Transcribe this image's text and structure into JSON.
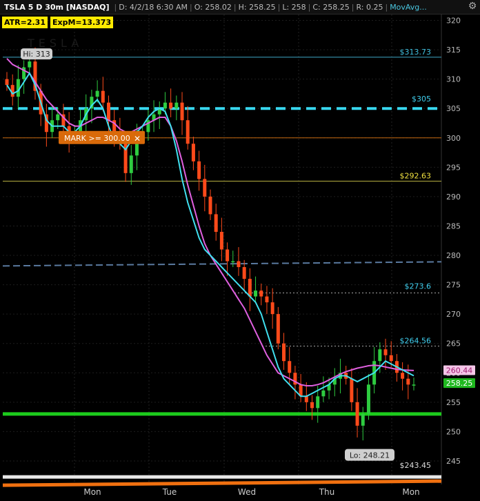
{
  "header": {
    "symbol": "TSLA 5 D 30m [NASDAQ]",
    "date": "D: 4/2/18 6:30 AM",
    "open": "O: 258.02",
    "high": "H: 258.25",
    "low": "L: 258",
    "close": "C: 258.25",
    "range": "R: 0.25",
    "study": "MovAvg..."
  },
  "studies": {
    "atr": "ATR=2.31",
    "expm": "ExpM=13.373"
  },
  "labels": {
    "hi": "Hi: 313",
    "lo": "Lo: 248.21",
    "mark": "MARK >= 300.00",
    "mark_close": "✕",
    "price_313": "$313.73",
    "price_305": "$305",
    "price_292": "$292.63",
    "price_273": "$273.6",
    "price_264": "$264.56",
    "price_243": "$243.45",
    "last_ma": "260.44",
    "last_price": "258.25"
  },
  "colors": {
    "up": "#2ecc40",
    "down": "#ff4a1a",
    "fast_ma": "#40e0f0",
    "slow_ma": "#e060e0",
    "support": "#1ccc1c",
    "resistance": "#38d8f0"
  },
  "chart_data": {
    "type": "line",
    "title": "TSLA 5 D 30m [NASDAQ]",
    "ylim": [
      241,
      321
    ],
    "y_ticks": [
      245,
      250,
      255,
      260,
      265,
      270,
      275,
      280,
      285,
      290,
      295,
      300,
      305,
      310,
      315,
      320
    ],
    "x_categories": [
      "Mon",
      "Tue",
      "Wed",
      "Thu",
      "Mon"
    ],
    "series": [
      {
        "name": "close",
        "values": [
          309,
          307,
          310,
          312,
          313,
          308,
          304,
          301,
          303,
          304,
          302,
          300,
          301,
          303,
          305,
          307,
          308,
          306,
          303,
          301,
          299,
          294,
          297,
          300,
          301,
          303,
          304,
          305,
          306,
          305,
          306,
          303,
          299,
          296,
          293,
          290,
          287,
          284,
          281,
          279,
          279,
          278,
          276,
          273,
          274,
          273,
          272,
          270,
          265,
          262,
          260,
          258,
          256,
          255,
          254,
          256,
          257,
          258,
          259,
          260,
          259,
          255,
          251,
          253,
          258,
          262,
          264,
          263,
          262,
          260,
          259,
          258,
          258
        ]
      },
      {
        "name": "fast moving average",
        "values": [
          309,
          307.5,
          308,
          309.5,
          311,
          309,
          306,
          303,
          302,
          302,
          302,
          301,
          301,
          302,
          304,
          305.5,
          306.5,
          305,
          302,
          299.5,
          299,
          298,
          299.5,
          301,
          302,
          303.5,
          304.5,
          305,
          304.5,
          302,
          298,
          293,
          289,
          286,
          283,
          281,
          280,
          279,
          278,
          277,
          276,
          275,
          274,
          273,
          272,
          270,
          267,
          264,
          261,
          259,
          258,
          257,
          256,
          256,
          256.5,
          257,
          257.5,
          258,
          259,
          259.5,
          259.5,
          259,
          258.5,
          259,
          259.5,
          260,
          261,
          262,
          261.5,
          261,
          260.5,
          260,
          259.5
        ]
      },
      {
        "name": "slow moving average",
        "values": [
          313.5,
          312.5,
          312,
          311.5,
          311,
          309.5,
          308,
          306.5,
          305.5,
          304.5,
          303.5,
          302.5,
          302,
          302,
          302.5,
          303,
          303.5,
          303.5,
          303,
          302.5,
          301.5,
          301,
          301,
          301.5,
          302,
          302.5,
          303,
          303.5,
          303.5,
          302,
          299.5,
          296,
          292,
          288.5,
          285,
          282,
          280,
          278.5,
          277,
          275.5,
          274,
          272.5,
          271,
          269,
          267,
          265,
          263,
          261.5,
          260,
          259.5,
          259,
          258.5,
          258,
          257.8,
          257.8,
          258,
          258.3,
          258.8,
          259.3,
          259.8,
          260.2,
          260.5,
          260.8,
          261,
          261.2,
          261.3,
          261.2,
          261,
          260.8,
          260.6,
          260.5,
          260.44,
          260.4
        ]
      }
    ],
    "levels": [
      {
        "label": "$313.73",
        "value": 313.73
      },
      {
        "label": "$305",
        "value": 305
      },
      {
        "label": "$292.63",
        "value": 292.63
      },
      {
        "label": "$273.6",
        "value": 273.6
      },
      {
        "label": "$264.56",
        "value": 264.56
      },
      {
        "label": "$243.45",
        "value": 243.45
      },
      {
        "label": "MARK >= 300.00",
        "value": 300
      }
    ],
    "support_level": 253,
    "hi": 313,
    "lo": 248.21,
    "last_price": 258.25,
    "last_ma": 260.44
  }
}
